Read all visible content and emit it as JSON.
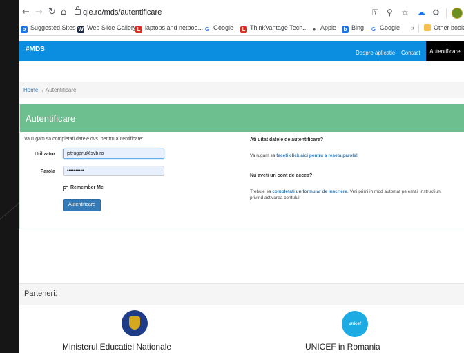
{
  "browser": {
    "url": "qie.ro/mds/autentificare",
    "bookmarks": [
      {
        "label": "Suggested Sites",
        "color": "#1a73e8",
        "glyph": "b"
      },
      {
        "label": "Web Slice Gallery",
        "color": "#1f2a44",
        "glyph": "W"
      },
      {
        "label": "laptops and netboo...",
        "color": "#d93025",
        "glyph": "L"
      },
      {
        "label": "Google",
        "color": "#ffffff",
        "glyph": "G"
      },
      {
        "label": "ThinkVantage Tech...",
        "color": "#d93025",
        "glyph": "L"
      },
      {
        "label": "Apple",
        "color": "#ffffff",
        "glyph": "●"
      },
      {
        "label": "Bing",
        "color": "#1a73e8",
        "glyph": "b"
      },
      {
        "label": "Google",
        "color": "#ffffff",
        "glyph": "G"
      }
    ],
    "other_bookmarks": "Other bookm"
  },
  "site": {
    "brand": "#MDS",
    "nav": [
      "Despre aplicatie",
      "Contact",
      "Autentificare"
    ],
    "breadcrumb": {
      "home": "Home",
      "sep": "/",
      "current": "Autentificare"
    }
  },
  "login": {
    "title": "Autentificare",
    "intro": "Va rugam sa completati datele dvs. pentru autentificare:",
    "user_label": "Utilizator",
    "user_value": "jstrugaru@svb.ro",
    "pass_label": "Parola",
    "pass_value": "••••••••••",
    "remember": "Remember Me",
    "submit": "Autentificare"
  },
  "help": {
    "forgot_heading": "Ati uitat datele de autentificare?",
    "forgot_pre": "Va rugam sa ",
    "forgot_link": "faceti click aici pentru a reseta parola!",
    "noaccount_heading": "Nu aveti un cont de acces?",
    "noaccount_pre": "Trebuie sa ",
    "noaccount_link": "completati un formular de inscriere",
    "noaccount_post": ". Veti primi in mod automat pe email instructiuni",
    "noaccount_line2": "privind activarea contului."
  },
  "partners": {
    "heading": "Parteneri:",
    "items": [
      "Ministerul Educatiei Nationale",
      "UNICEF in Romania"
    ],
    "unicef_logo_text": "unicef"
  }
}
